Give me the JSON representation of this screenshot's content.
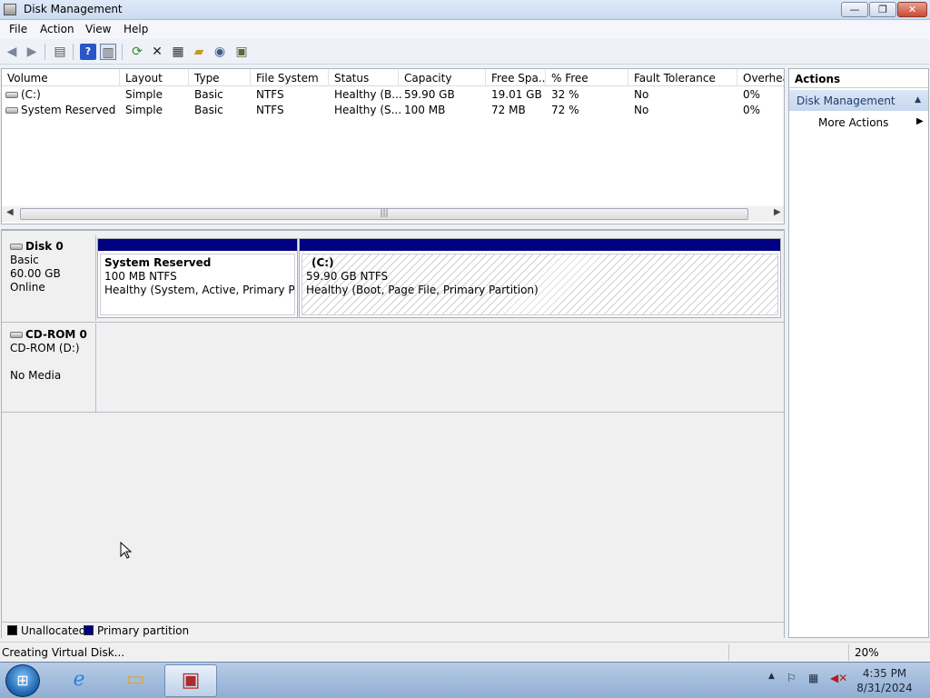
{
  "window": {
    "title": "Disk Management",
    "buttons": {
      "minimize": "—",
      "maximize": "❐",
      "close": "✕"
    }
  },
  "menu": [
    "File",
    "Action",
    "View",
    "Help"
  ],
  "toolbar_icons": [
    "back-arrow-icon",
    "forward-arrow-icon",
    "show-hide-tree-icon",
    "help-icon",
    "show-hide-action-pane-icon",
    "refresh-icon",
    "delete-icon",
    "properties-icon",
    "open-icon",
    "explore-icon",
    "rescan-icon"
  ],
  "volumes": {
    "columns": [
      "Volume",
      "Layout",
      "Type",
      "File System",
      "Status",
      "Capacity",
      "Free Spa...",
      "% Free",
      "Fault Tolerance",
      "Overhead"
    ],
    "rows": [
      [
        "(C:)",
        "Simple",
        "Basic",
        "NTFS",
        "Healthy (B...",
        "59.90 GB",
        "19.01 GB",
        "32 %",
        "No",
        "0%"
      ],
      [
        "System Reserved",
        "Simple",
        "Basic",
        "NTFS",
        "Healthy (S...",
        "100 MB",
        "72 MB",
        "72 %",
        "No",
        "0%"
      ]
    ],
    "scroll_grip": "|||"
  },
  "disks": [
    {
      "name": "Disk 0",
      "type": "Basic",
      "size": "60.00 GB",
      "state": "Online",
      "partitions": [
        {
          "name": "System Reserved",
          "size": "100 MB NTFS",
          "status": "Healthy (System, Active, Primary Partiti"
        },
        {
          "name": "(C:)",
          "size": "59.90 GB NTFS",
          "status": "Healthy (Boot, Page File, Primary Partition)"
        }
      ]
    },
    {
      "name": "CD-ROM 0",
      "type": "CD-ROM (D:)",
      "state": "No Media"
    }
  ],
  "legend": [
    {
      "label": "Unallocated",
      "color": "#000000"
    },
    {
      "label": "Primary partition",
      "color": "#000080"
    }
  ],
  "actions": {
    "header": "Actions",
    "section": "Disk Management",
    "more": "More Actions"
  },
  "status": {
    "text": "Creating Virtual Disk...",
    "percent": "20%"
  },
  "taskbar": {
    "apps": [
      "start-orb",
      "internet-explorer",
      "windows-explorer",
      "computer-management"
    ],
    "time": "4:35 PM",
    "date": "8/31/2024"
  }
}
